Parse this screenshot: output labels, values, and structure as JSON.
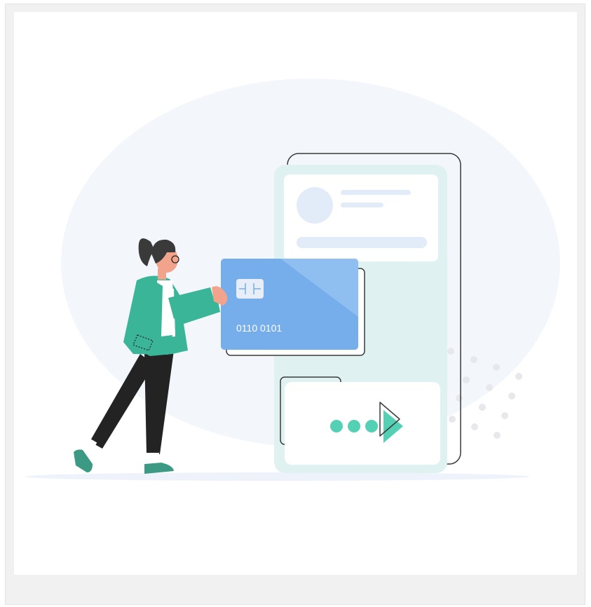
{
  "illustration": {
    "card_number": "0110 0101",
    "colors": {
      "blob": "#f3f7fc",
      "phone_bg": "#dff2f1",
      "card": "#76aeeb",
      "card_light": "#9ac6f3",
      "jacket": "#3ab598",
      "accent_teal": "#54d1b4",
      "pants": "#232323",
      "hair": "#3a3a3a",
      "skin": "#f2a38c",
      "placeholder": "#e2ecf8"
    }
  }
}
